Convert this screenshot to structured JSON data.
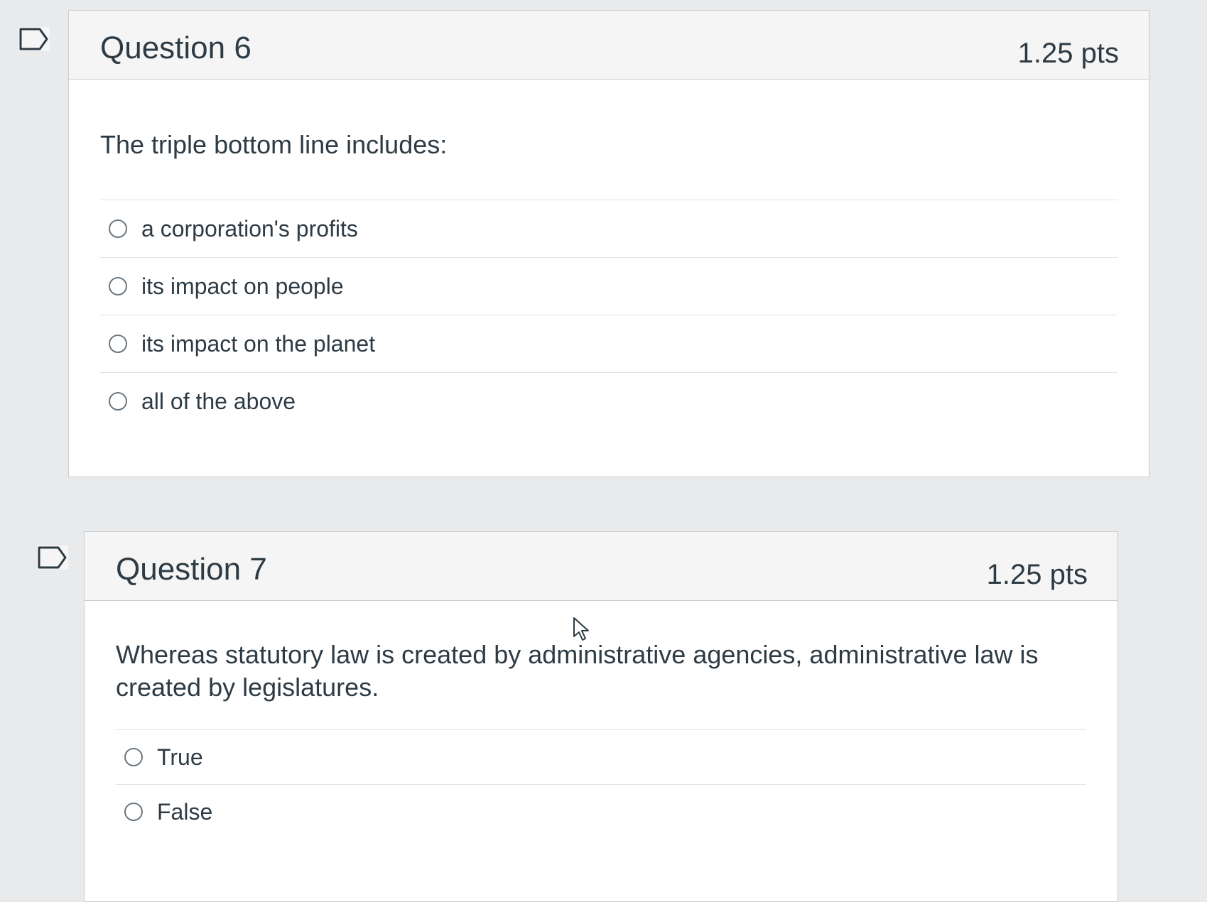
{
  "questions": [
    {
      "title": "Question 6",
      "points": "1.25 pts",
      "text": "The triple bottom line includes:",
      "answers": [
        "a corporation's profits",
        "its impact on people",
        "its impact on the planet",
        "all of the above"
      ]
    },
    {
      "title": "Question 7",
      "points": "1.25 pts",
      "text": "Whereas statutory law is created by administrative agencies, administrative law is created by legislatures.",
      "answers": [
        "True",
        "False"
      ]
    }
  ],
  "icons": {
    "flag": "flag-question-icon",
    "cursor": "mouse-pointer-icon"
  }
}
